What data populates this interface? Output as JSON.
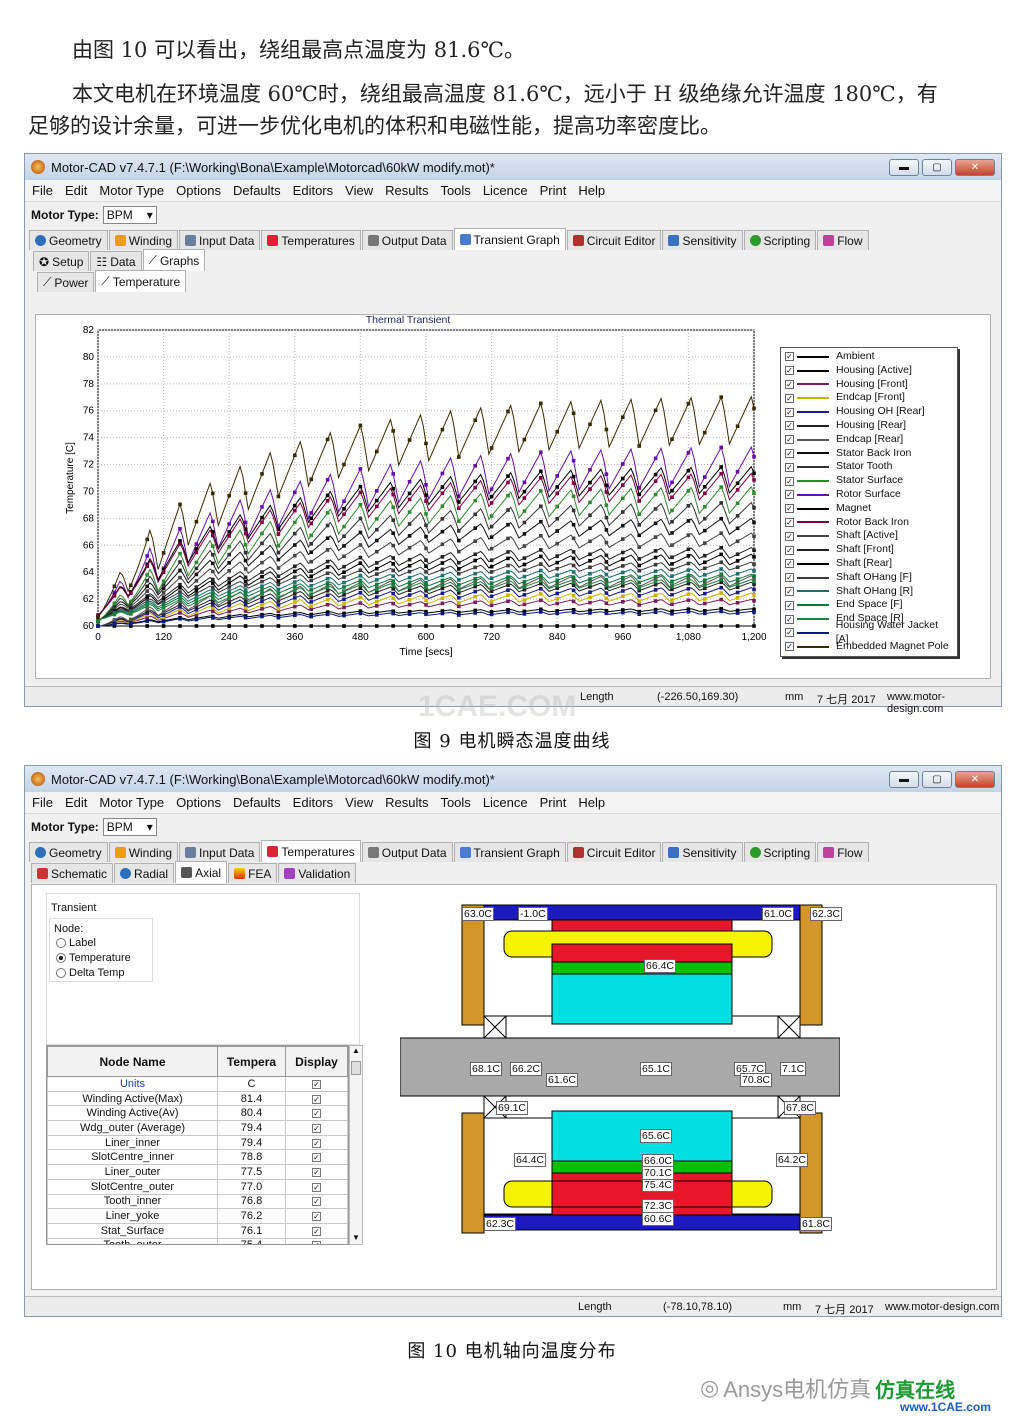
{
  "text": {
    "line1": "由图 10 可以看出，绕组最高点温度为 81.6℃。",
    "line2": "本文电机在环境温度 60℃时，绕组最高温度 81.6℃，远小于 H 级绝缘允许温度 180℃，有",
    "line3": "足够的设计余量，可进一步优化电机的体积和电磁性能，提高功率密度比。"
  },
  "window": {
    "title": "Motor-CAD v7.4.7.1 (F:\\Working\\Bona\\Example\\Motorcad\\60kW modify.mot)*",
    "menu": [
      "File",
      "Edit",
      "Motor Type",
      "Options",
      "Defaults",
      "Editors",
      "View",
      "Results",
      "Tools",
      "Licence",
      "Print",
      "Help"
    ],
    "motor_type_label": "Motor Type:",
    "motor_type_value": "BPM",
    "main_tabs": [
      "Geometry",
      "Winding",
      "Input Data",
      "Temperatures",
      "Output Data",
      "Transient Graph",
      "Circuit Editor",
      "Sensitivity",
      "Scripting",
      "Flow"
    ]
  },
  "fig9": {
    "sub_tabs": [
      "Setup",
      "Data",
      "Graphs"
    ],
    "graph_tabs": [
      "Power",
      "Temperature"
    ],
    "status": {
      "label": "Length",
      "coords": "(-226.50,169.30)",
      "unit": "mm",
      "date": "7 七月 2017",
      "site": "www.motor-design.com"
    },
    "caption": "图 9   电机瞬态温度曲线"
  },
  "fig10": {
    "sub_tabs": [
      "Schematic",
      "Radial",
      "Axial",
      "FEA",
      "Validation"
    ],
    "radio_title": "Transient",
    "radio_group": "Node:",
    "radio_options": [
      "Label",
      "Temperature",
      "Delta Temp"
    ],
    "table_headers": [
      "Node Name",
      "Tempera",
      "Display"
    ],
    "table_rows": [
      [
        "Units",
        "C"
      ],
      [
        "Winding Active(Max)",
        "81.4"
      ],
      [
        "Winding Active(Av)",
        "80.4"
      ],
      [
        "Wdg_outer (Average)",
        "79.4"
      ],
      [
        "Liner_inner",
        "79.4"
      ],
      [
        "SlotCentre_inner",
        "78.8"
      ],
      [
        "Liner_outer",
        "77.5"
      ],
      [
        "SlotCentre_outer",
        "77.0"
      ],
      [
        "Tooth_inner",
        "76.8"
      ],
      [
        "Liner_yoke",
        "76.2"
      ],
      [
        "Stat_Surface",
        "76.1"
      ],
      [
        "Tooth_outer",
        "75.4"
      ]
    ],
    "temp_labels": [
      "63.0C",
      "-1.0C",
      "61.0C",
      "62.3C",
      "66.4C",
      "68.1C",
      "66.2C",
      "61.6C",
      "65.1C",
      "65.7C",
      "7.1C",
      "70.8C",
      "69.1C",
      "67.8C",
      "65.6C",
      "64.4C",
      "66.0C",
      "64.2C",
      "75.4C",
      "72.3C",
      "60.6C",
      "62.3C",
      "61.8C",
      "70.1C"
    ],
    "status": {
      "label": "Length",
      "coords": "(-78.10,78.10)",
      "unit": "mm",
      "date": "7 七月 2017",
      "site": "www.motor-design.com"
    },
    "caption": "图 10   电机轴向温度分布"
  },
  "watermarks": {
    "center": "1CAE.COM",
    "bottom_brand": "Ansys电机仿真",
    "bottom_green": "仿真在线",
    "bottom_url": "www.1CAE.com"
  },
  "chart_data": {
    "type": "line",
    "title": "Thermal Transient",
    "xlabel": "Time [secs]",
    "ylabel": "Temperature [C]",
    "xlim": [
      0,
      1200
    ],
    "ylim": [
      60,
      82
    ],
    "x_ticks": [
      "0",
      "120",
      "240",
      "360",
      "480",
      "600",
      "720",
      "840",
      "960",
      "1,080",
      "1,200"
    ],
    "y_ticks": [
      "60",
      "62",
      "64",
      "66",
      "68",
      "70",
      "72",
      "74",
      "76",
      "78",
      "80",
      "82"
    ],
    "legend_placement": "right",
    "series": [
      {
        "name": "Ambient",
        "color": "#000000",
        "start": 60,
        "end": 60,
        "amp": 0
      },
      {
        "name": "Housing [Active]",
        "color": "#000000",
        "start": 60,
        "end": 61.2,
        "amp": 0.1
      },
      {
        "name": "Housing [Front]",
        "color": "#7a1f5a",
        "start": 60,
        "end": 61.8,
        "amp": 0.2
      },
      {
        "name": "Endcap [Front]",
        "color": "#c8b400",
        "start": 60,
        "end": 62.2,
        "amp": 0.3
      },
      {
        "name": "Housing OH [Rear]",
        "color": "#1a1a8a",
        "start": 60,
        "end": 62.6,
        "amp": 0.3
      },
      {
        "name": "Housing [Rear]",
        "color": "#222222",
        "start": 60,
        "end": 63.0,
        "amp": 0.3
      },
      {
        "name": "Endcap [Rear]",
        "color": "#555555",
        "start": 60,
        "end": 63.4,
        "amp": 0.4
      },
      {
        "name": "Stator Back Iron",
        "color": "#111111",
        "start": 60.5,
        "end": 67.5,
        "amp": 0.6
      },
      {
        "name": "Stator Tooth",
        "color": "#333333",
        "start": 60.5,
        "end": 68.5,
        "amp": 0.8
      },
      {
        "name": "Stator Surface",
        "color": "#2e8b2e",
        "start": 60.5,
        "end": 69.5,
        "amp": 1.0
      },
      {
        "name": "Rotor Surface",
        "color": "#6a0dad",
        "start": 61,
        "end": 72,
        "amp": 1.5
      },
      {
        "name": "Magnet",
        "color": "#000000",
        "start": 61,
        "end": 71,
        "amp": 1.0
      },
      {
        "name": "Rotor Back Iron",
        "color": "#800040",
        "start": 61,
        "end": 70.5,
        "amp": 1.0
      },
      {
        "name": "Shaft [Active]",
        "color": "#444444",
        "start": 60.5,
        "end": 66.5,
        "amp": 0.5
      },
      {
        "name": "Shaft [Front]",
        "color": "#222222",
        "start": 60.5,
        "end": 65.5,
        "amp": 0.4
      },
      {
        "name": "Shaft [Rear]",
        "color": "#000000",
        "start": 60.5,
        "end": 65.0,
        "amp": 0.4
      },
      {
        "name": "Shaft OHang [F]",
        "color": "#3a3a3a",
        "start": 60.5,
        "end": 64.5,
        "amp": 0.3
      },
      {
        "name": "Shaft OHang [R]",
        "color": "#1f6f6f",
        "start": 60.5,
        "end": 64.0,
        "amp": 0.3
      },
      {
        "name": "End Space [F]",
        "color": "#0b7a3a",
        "start": 60.5,
        "end": 63.6,
        "amp": 0.3
      },
      {
        "name": "End Space [R]",
        "color": "#208040",
        "start": 60.5,
        "end": 63.2,
        "amp": 0.3
      },
      {
        "name": "Housing Water Jacket [A]",
        "color": "#0a1a80",
        "start": 60,
        "end": 61.0,
        "amp": 0.1
      },
      {
        "name": "Embedded Magnet Pole",
        "color": "#3a2a00",
        "start": 61,
        "end": 75.5,
        "amp": 1.8
      }
    ]
  },
  "colors": {
    "winding": "#e8162a",
    "slot": "#00e0e0",
    "shaft": "#a9a9a9",
    "housing": "#d2962a",
    "endwind": "#f4f400",
    "core": "#00c000",
    "frame": "#1a1abf"
  }
}
